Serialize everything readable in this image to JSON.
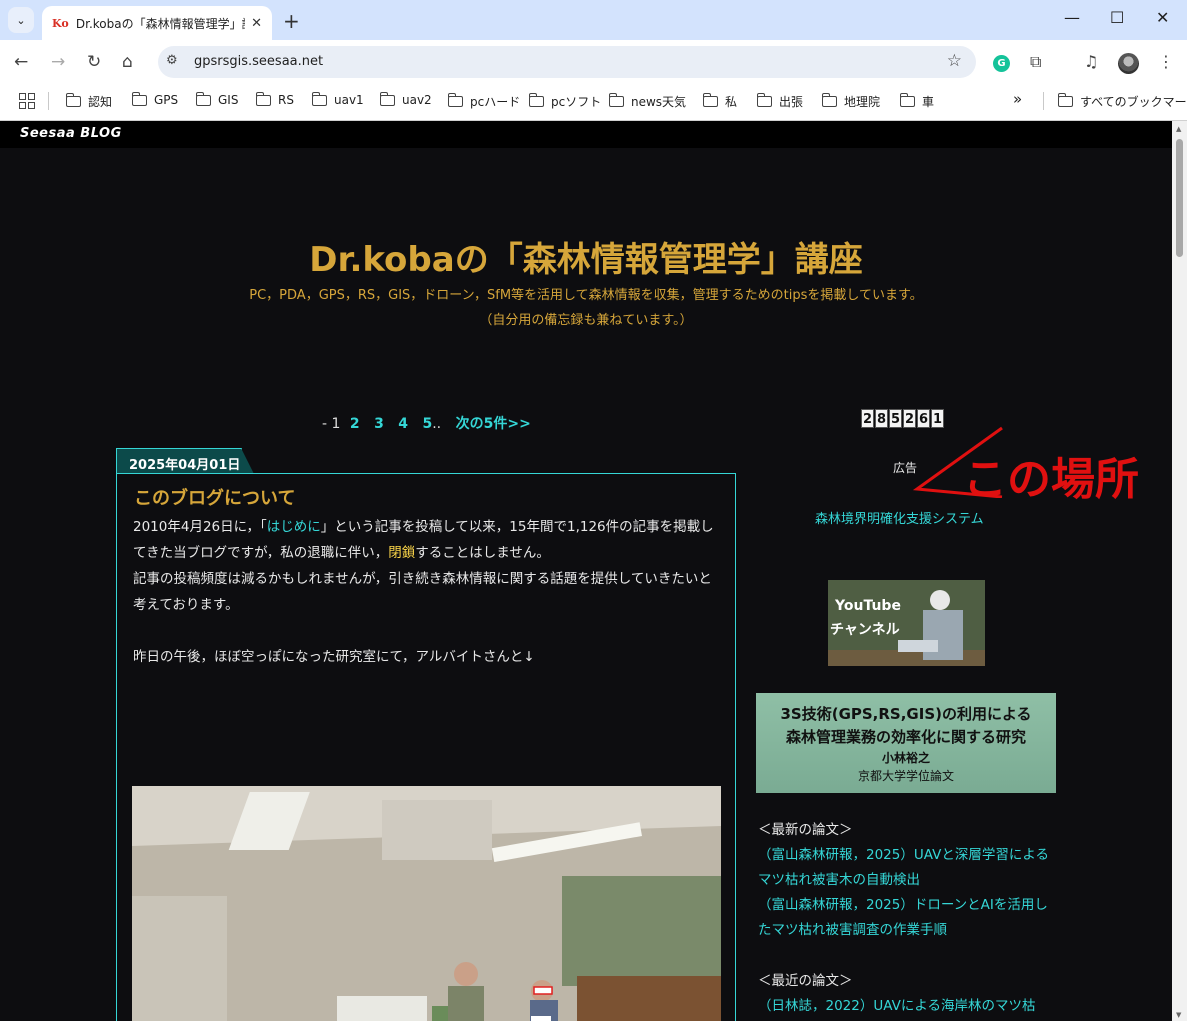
{
  "browser": {
    "tab_title": "Dr.kobaの「森林情報管理学」講座",
    "tab_favicon": "Ko",
    "url": "gpsrsgis.seesaa.net",
    "bookmarks": [
      "認知",
      "GPS",
      "GIS",
      "RS",
      "uav1",
      "uav2",
      "pcハード",
      "pcソフト",
      "news天気",
      "私",
      "出張",
      "地理院",
      "車"
    ],
    "all_bookmarks": "すべてのブックマーク",
    "more_bookmarks": "»"
  },
  "seesaa": {
    "logo": "Seesaa BLOG"
  },
  "blog": {
    "title": "Dr.kobaの「森林情報管理学」講座",
    "desc1": "PC，PDA，GPS，RS，GIS，ドローン，SfM等を活用して森林情報を収集，管理するためのtipsを掲載しています。",
    "desc2": "（自分用の備忘録も兼ねています。）"
  },
  "pager": {
    "prefix": "- 1",
    "pages": [
      "2",
      "3",
      "4",
      "5"
    ],
    "ellipsis": "..",
    "next": "次の5件>>"
  },
  "post": {
    "date": "2025年04月01日",
    "title": "このブログについて",
    "p1_a": "2010年4月26日に，「",
    "p1_link": "はじめに",
    "p1_b": "」という記事を投稿して以来，15年間で1,126件の記事を掲載してきた当ブログですが，私の退職に伴い，",
    "p1_highlight": "閉鎖",
    "p1_c": "することはしません。",
    "p2": "記事の投稿頻度は減るかもしれませんが，引き続き森林情報に関する話題を提供していきたいと考えております。",
    "p3": "昨日の午後，ほぼ空っぽになった研究室にて，アルバイトさんと↓"
  },
  "sidebar": {
    "counter": [
      "2",
      "8",
      "5",
      "2",
      "6",
      "1"
    ],
    "ad_label": "広告",
    "annotation": "この場所",
    "system_link": "森林境界明確化支援システム",
    "youtube_line1": "YouTube",
    "youtube_line2": "チャンネル",
    "thesis_line1": "3S技術(GPS,RS,GIS)の利用による",
    "thesis_line2": "森林管理業務の効率化に関する研究",
    "thesis_author": "小林裕之",
    "thesis_type": "京都大学学位論文",
    "latest_heading": "＜最新の論文＞",
    "latest_1": "（富山森林研報，2025）UAVと深層学習によるマツ枯れ被害木の自動検出",
    "latest_2": "（富山森林研報，2025）ドローンとAIを活用したマツ枯れ被害調査の作業手順",
    "recent_heading": "＜最近の論文＞",
    "recent_1": "（日林誌，2022）UAVによる海岸林のマツ枯"
  },
  "colors": {
    "accent": "#35d6d6",
    "title_gold": "#d6a63a",
    "annotation_red": "#e01010"
  }
}
